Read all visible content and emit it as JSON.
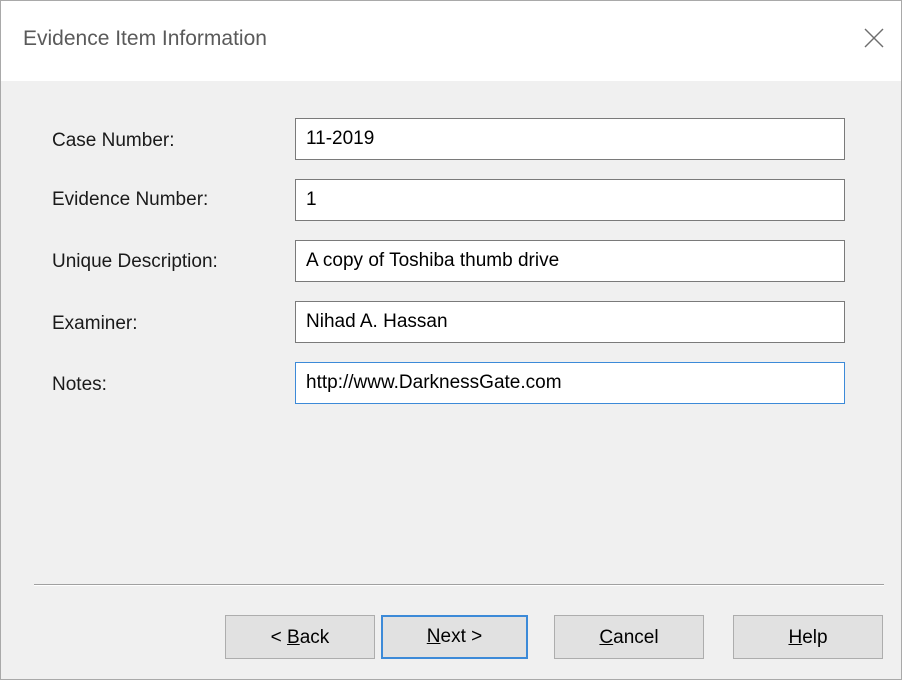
{
  "window": {
    "title": "Evidence Item Information",
    "close_label": "close"
  },
  "form": {
    "case_number": {
      "label": "Case Number:",
      "value": "11-2019"
    },
    "evidence_number": {
      "label": "Evidence Number:",
      "value": "1"
    },
    "unique_description": {
      "label": "Unique Description:",
      "value": "A copy of Toshiba thumb drive"
    },
    "examiner": {
      "label": "Examiner:",
      "value": "Nihad A. Hassan"
    },
    "notes": {
      "label": "Notes:",
      "value": "http://www.DarknessGate.com"
    }
  },
  "buttons": {
    "back": {
      "prefix": "< ",
      "mnemonic": "B",
      "rest": "ack"
    },
    "next": {
      "mnemonic": "N",
      "rest": "ext >"
    },
    "cancel": {
      "mnemonic": "C",
      "rest": "ancel"
    },
    "help": {
      "mnemonic": "H",
      "rest": "elp"
    }
  },
  "colors": {
    "focus_border": "#3c8ad8",
    "dialog_background": "#f0f0f0",
    "titlebar_background": "#ffffff"
  },
  "icons": {
    "close": "close-icon"
  }
}
